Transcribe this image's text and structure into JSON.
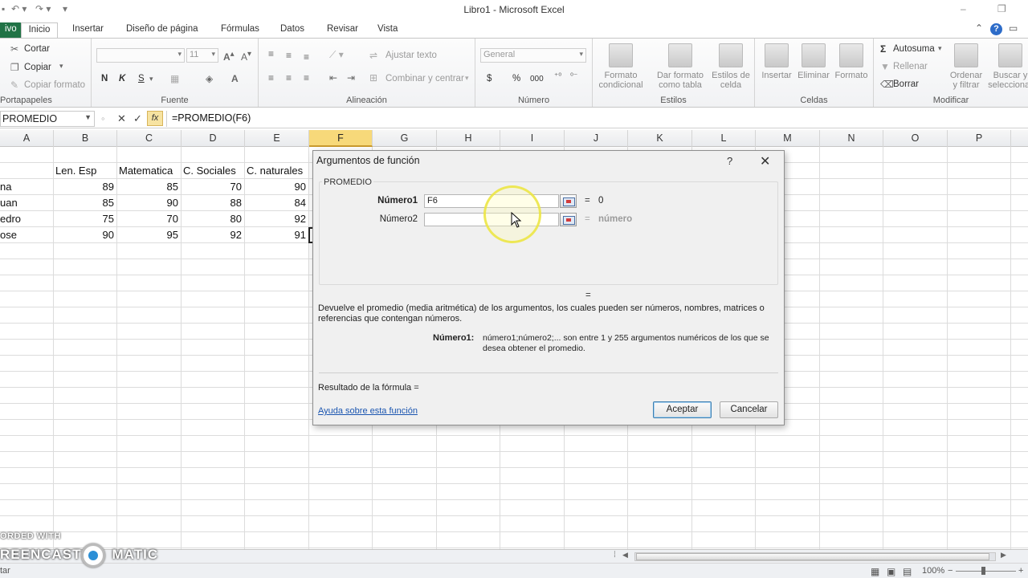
{
  "window": {
    "title": "Libro1  -  Microsoft Excel"
  },
  "tabs": [
    {
      "label": "ivo"
    },
    {
      "label": "Inicio"
    },
    {
      "label": "Insertar"
    },
    {
      "label": "Diseño de página"
    },
    {
      "label": "Fórmulas"
    },
    {
      "label": "Datos"
    },
    {
      "label": "Revisar"
    },
    {
      "label": "Vista"
    }
  ],
  "ribbon": {
    "clipboard": {
      "group": "Portapapeles",
      "cut": "Cortar",
      "copy": "Copiar",
      "format_painter": "Copiar formato"
    },
    "font": {
      "group": "Fuente",
      "size": "11",
      "bold": "N",
      "italic": "K",
      "underline": "S"
    },
    "alignment": {
      "group": "Alineación",
      "wrap": "Ajustar texto",
      "merge": "Combinar y centrar"
    },
    "number": {
      "group": "Número",
      "format": "General",
      "currency": "$",
      "percent": "%",
      "thousands": "000"
    },
    "styles": {
      "group": "Estilos",
      "conditional": [
        "Formato",
        "condicional"
      ],
      "as_table": [
        "Dar formato",
        "como tabla"
      ],
      "cell_styles": [
        "Estilos de",
        "celda"
      ]
    },
    "cells": {
      "group": "Celdas",
      "insert": "Insertar",
      "delete": "Eliminar",
      "format": "Formato"
    },
    "editing": {
      "group": "Modificar",
      "autosum": "Autosuma",
      "fill": "Rellenar",
      "clear": "Borrar",
      "sort": [
        "Ordenar",
        "y filtrar"
      ],
      "find": [
        "Buscar y",
        "seleccionar"
      ]
    }
  },
  "formula_bar": {
    "name_box": "PROMEDIO",
    "formula": "=PROMEDIO(F6)",
    "fx": "fx"
  },
  "columns": [
    "A",
    "B",
    "C",
    "D",
    "E",
    "F",
    "G",
    "H",
    "I",
    "J",
    "K",
    "L",
    "M",
    "N",
    "O",
    "P"
  ],
  "sheet": {
    "headers": [
      "Len. Esp",
      "Matematica",
      "C. Sociales",
      "C. naturales"
    ],
    "rows": [
      {
        "name": "na",
        "values": [
          "89",
          "85",
          "70",
          "90"
        ]
      },
      {
        "name": "uan",
        "values": [
          "85",
          "90",
          "88",
          "84"
        ]
      },
      {
        "name": "edro",
        "values": [
          "75",
          "70",
          "80",
          "92"
        ]
      },
      {
        "name": "ose",
        "values": [
          "90",
          "95",
          "92",
          "91"
        ]
      }
    ]
  },
  "dialog": {
    "title": "Argumentos de función",
    "help": "?",
    "close": "✕",
    "function_name": "PROMEDIO",
    "arg1_label": "Número1",
    "arg1_value": "F6",
    "arg1_result": "0",
    "arg2_label": "Número2",
    "arg2_value": "",
    "arg2_result": "número",
    "equals": "=",
    "description": "Devuelve el promedio (media aritmética) de los argumentos, los cuales pueden ser números, nombres, matrices o referencias que contengan números.",
    "arg_desc_label": "Número1:",
    "arg_desc_text": "número1;número2;... son entre 1 y 255 argumentos numéricos de los que se desea obtener el promedio.",
    "result_label": "Resultado de la fórmula =",
    "help_link": "Ayuda sobre esta función",
    "ok": "Aceptar",
    "cancel": "Cancelar"
  },
  "status": {
    "left": "tar",
    "zoom": "100%"
  },
  "watermark": {
    "line1": "ORDED WITH",
    "line2": "REENCAST",
    "line3": "MATIC"
  }
}
